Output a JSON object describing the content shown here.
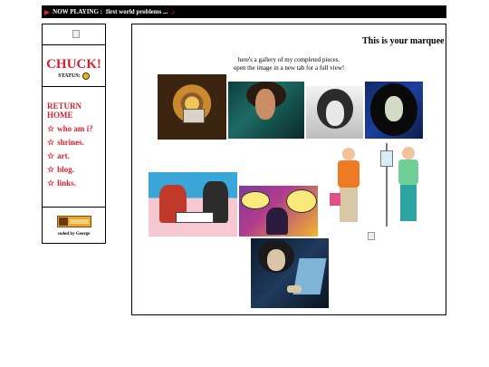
{
  "now_playing": {
    "label": "NOW PLAYING :",
    "track": "first world problems ..."
  },
  "sidebar": {
    "site_name": "CHUCK!",
    "status_label": "STATUS:",
    "nav": [
      {
        "label": "RETURN HOME",
        "star": ""
      },
      {
        "label": "who am i?",
        "star": "☆"
      },
      {
        "label": "shrines.",
        "star": "☆"
      },
      {
        "label": "art.",
        "star": "☆"
      },
      {
        "label": "blog.",
        "star": "☆"
      },
      {
        "label": "links.",
        "star": "☆"
      }
    ],
    "credit": "coded by George"
  },
  "main": {
    "marquee": "This is your marquee",
    "intro_line1": "here's a gallery of my completed pieces.",
    "intro_line2": "open the image in a new tab for a full view!"
  },
  "colors": {
    "accent": "#d8212f",
    "bar": "#000000",
    "background": "#ffffff"
  },
  "icons": {
    "play": "play-triangle-icon",
    "status": "smiley-icon",
    "nav_star": "star-outline-icon",
    "broken_image": "broken-image-icon"
  }
}
